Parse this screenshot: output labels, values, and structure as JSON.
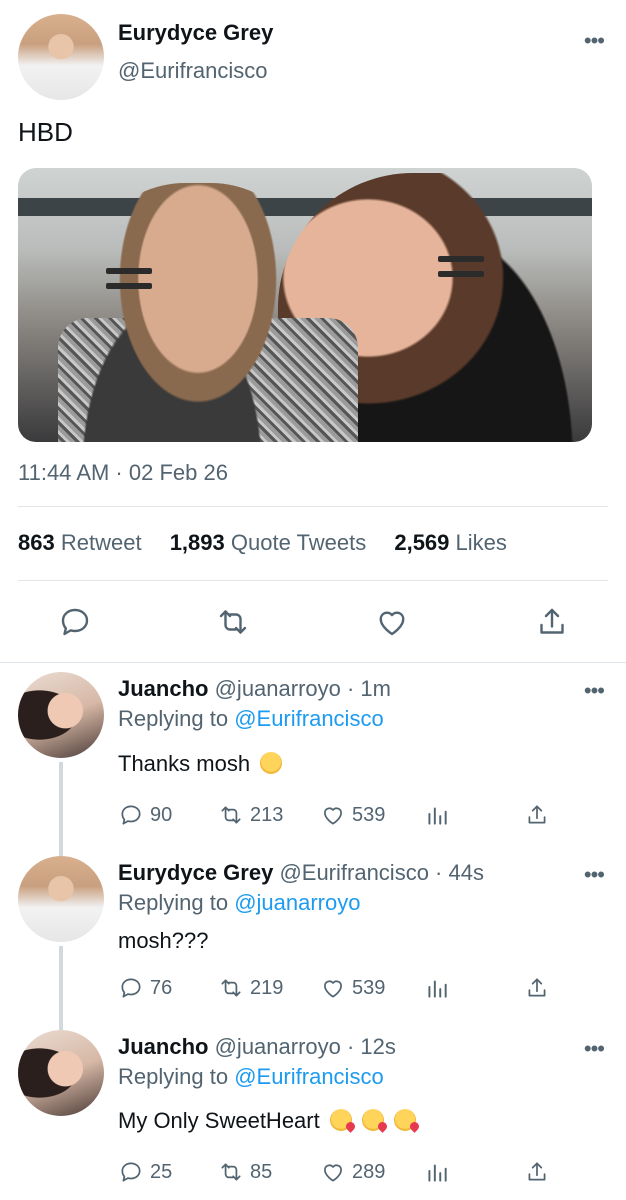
{
  "tweet": {
    "author_name": "Eurydyce Grey",
    "author_handle": "@Eurifrancisco",
    "text": "HBD",
    "timestamp": "11:44 AM · 02 Feb 26",
    "stats": [
      {
        "value": "863",
        "label": "Retweet"
      },
      {
        "value": "1,893",
        "label": "Quote Tweets"
      },
      {
        "value": "2,569",
        "label": "Likes"
      }
    ],
    "more_label": "•••"
  },
  "replies": [
    {
      "name": "Juancho",
      "meta": "@juanarroyo · 1m",
      "replying_prefix": "Replying to ",
      "replying_to": "@Eurifrancisco",
      "text": "Thanks mosh",
      "emoji": [
        "smile"
      ],
      "replies": "90",
      "retweets": "213",
      "likes": "539"
    },
    {
      "name": "Eurydyce Grey",
      "meta": "@Eurifrancisco · 44s",
      "replying_prefix": "Replying to ",
      "replying_to": "@juanarroyo",
      "text": "mosh???",
      "emoji": [],
      "replies": "76",
      "retweets": "219",
      "likes": "539"
    },
    {
      "name": "Juancho",
      "meta": "@juanarroyo · 12s",
      "replying_prefix": "Replying to ",
      "replying_to": "@Eurifrancisco",
      "text": "My Only SweetHeart",
      "emoji": [
        "smiling-face-with-hearts",
        "smiling-face-with-hearts",
        "smiling-face-with-hearts"
      ],
      "replies": "25",
      "retweets": "85",
      "likes": "289"
    }
  ],
  "colors": {
    "link": "#1d9bf0",
    "secondary_text": "#536471",
    "primary_text": "#0f1419",
    "divider": "#e1e6ea"
  }
}
